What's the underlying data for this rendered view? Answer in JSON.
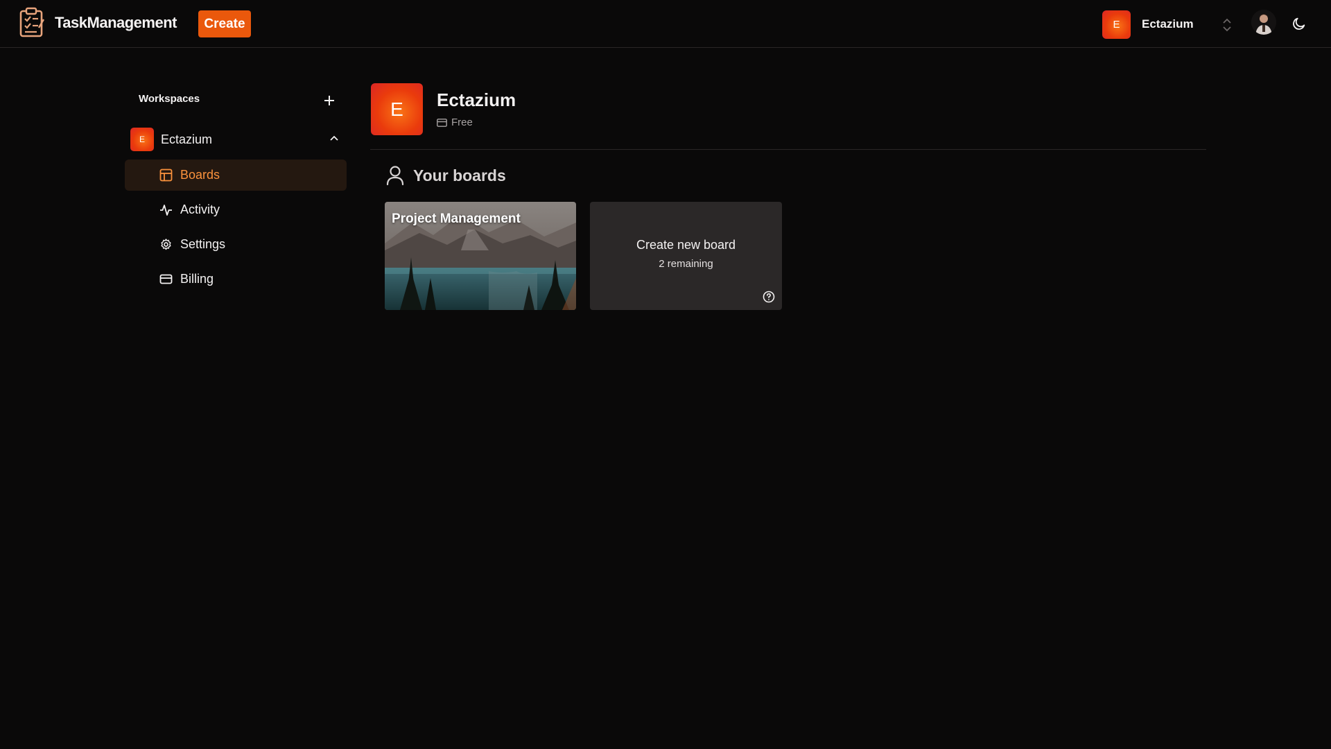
{
  "app": {
    "title": "TaskManagement",
    "create_label": "Create"
  },
  "topbar": {
    "workspace_name": "Ectazium",
    "workspace_initial": "E"
  },
  "sidebar": {
    "header": "Workspaces",
    "workspace": {
      "initial": "E",
      "name": "Ectazium"
    },
    "items": [
      {
        "label": "Boards",
        "icon": "layout-icon",
        "active": true
      },
      {
        "label": "Activity",
        "icon": "activity-icon",
        "active": false
      },
      {
        "label": "Settings",
        "icon": "gear-icon",
        "active": false
      },
      {
        "label": "Billing",
        "icon": "credit-card-icon",
        "active": false
      }
    ]
  },
  "main": {
    "workspace_initial": "E",
    "workspace_name": "Ectazium",
    "plan": "Free",
    "boards_heading": "Your boards",
    "boards": [
      {
        "title": "Project Management"
      }
    ],
    "new_board": {
      "label": "Create new board",
      "remaining": "2 remaining"
    }
  },
  "colors": {
    "accent": "#ea580c",
    "active_text": "#fb923c",
    "background": "#0a0909",
    "card_bg": "#2b2828"
  }
}
